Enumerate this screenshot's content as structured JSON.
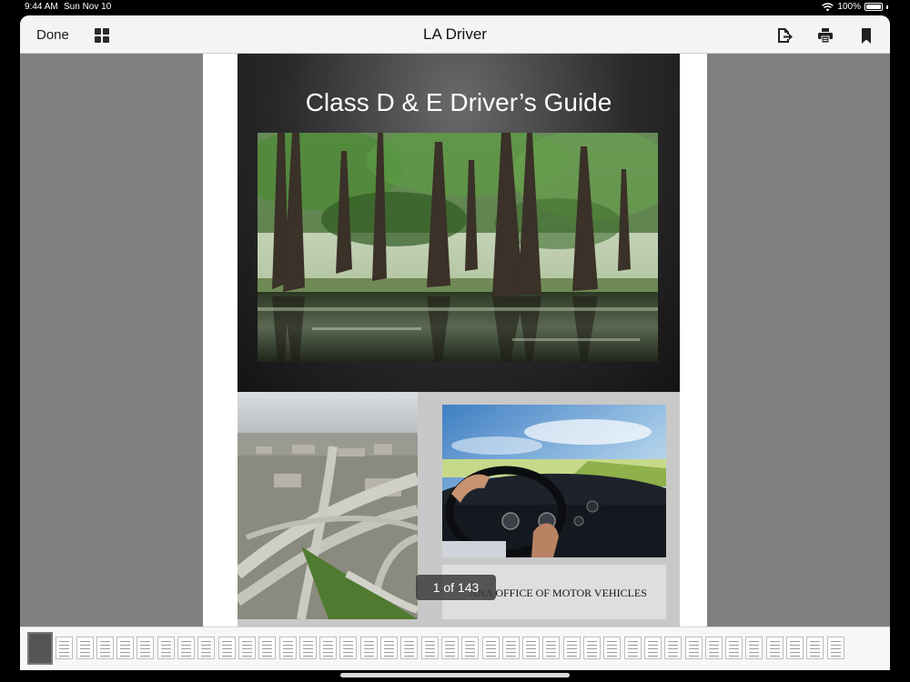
{
  "status_bar": {
    "time": "9:44 AM",
    "date": "Sun Nov 10",
    "battery": "100%"
  },
  "navbar": {
    "done_label": "Done",
    "title": "LA Driver",
    "icons": [
      "grid-view-icon",
      "share-icon",
      "print-icon",
      "bookmark-icon"
    ]
  },
  "document": {
    "cover_title": "Class D & E Driver’s Guide",
    "office_text": "ANA OFFICE OF MOTOR VEHICLES"
  },
  "page_counter": "1 of 143",
  "thumbnails": {
    "selected_index": 0
  }
}
